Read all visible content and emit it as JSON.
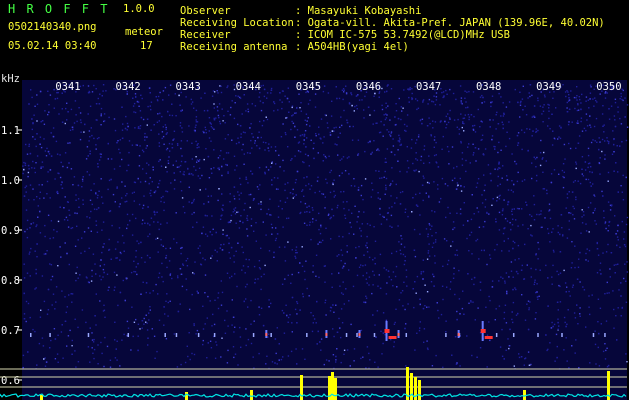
{
  "header": {
    "app_name": "H R O F F T",
    "version": "1.0.0",
    "filename": "0502140340.png",
    "date_time": "05.02.14 03:40",
    "meteor_label": "meteor",
    "meteor_count": "17",
    "info": [
      {
        "key": "Observer",
        "value": ": Masayuki Kobayashi"
      },
      {
        "key": "Receiving Location",
        "value": ": Ogata-vill. Akita-Pref. JAPAN (139.96E, 40.02N)"
      },
      {
        "key": "Receiver",
        "value": ": ICOM IC-575 53.7492(@LCD)MHz USB"
      },
      {
        "key": "Receiving antenna",
        "value": ": A504HB(yagi 4el)"
      }
    ]
  },
  "spectrogram": {
    "y_unit": "kHz",
    "time_labels": [
      "0341",
      "0342",
      "0343",
      "0344",
      "0345",
      "0346",
      "0347",
      "0348",
      "0349",
      "0350"
    ],
    "freq_labels": [
      "1.1",
      "1.0",
      "0.9",
      "0.8",
      "0.7",
      "0.6"
    ],
    "freq_values": [
      1.1,
      1.0,
      0.9,
      0.8,
      0.7,
      0.6
    ],
    "colors": {
      "background_noise": "#1a1a9a",
      "grid": "#d8d8b0",
      "signal_peak": "#ff3333",
      "histogram_bar": "#ffff00",
      "noise_trace": "#00e5e5"
    },
    "meteor_minutes": [
      3.3,
      4.3,
      4.85,
      5.3,
      5.5,
      6.5,
      6.9
    ]
  }
}
